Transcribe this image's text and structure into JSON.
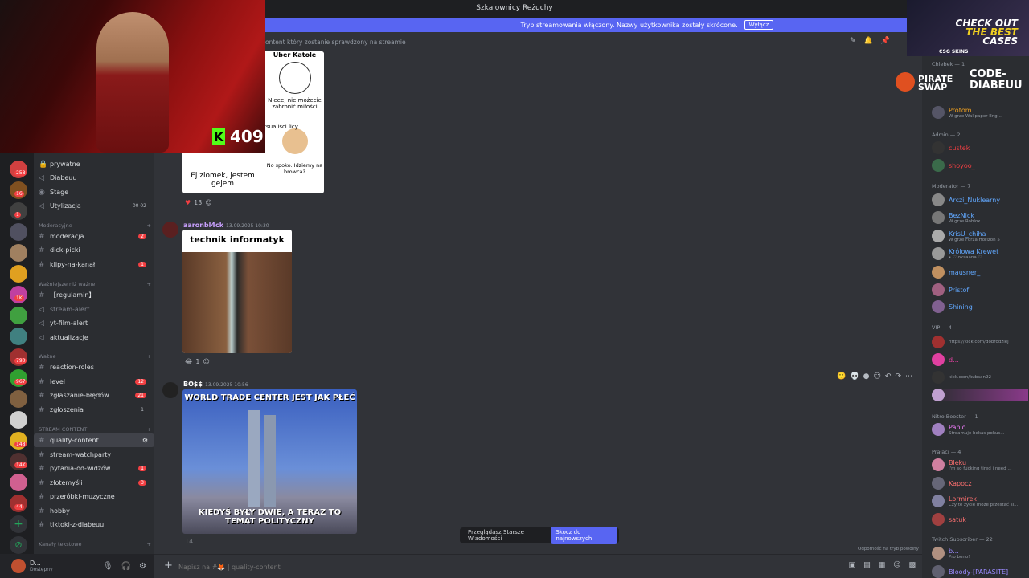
{
  "window": {
    "title": "Szkalownicy Reżuchy"
  },
  "banner": {
    "text": "Tryb streamowania włączony. Nazwy użytkownika zostały skrócone.",
    "button": "Wyłącz"
  },
  "stream": {
    "kick_count": "409"
  },
  "ads": {
    "ad1_line1": "CHECK OUT",
    "ad1_line2": "THE BEST",
    "ad1_line3": "CASES",
    "ad1_brand": "CSG SKINS",
    "ad2_left": "PIRATE SWAP",
    "ad2_right_1": "CODE-",
    "ad2_right_2": "DIABEUU"
  },
  "channel_header": {
    "desc": "ontent który zostanie sprawdzony na streamie"
  },
  "server_badges": [
    "258",
    "16",
    "1",
    "1K",
    "790",
    "967",
    "148",
    "14K",
    "44"
  ],
  "channels": {
    "top": [
      {
        "label": "prywatne"
      },
      {
        "label": "Diabeuu"
      },
      {
        "label": "Stage"
      },
      {
        "label": "Utylizacja",
        "extra": "00 02"
      }
    ],
    "cat_moderacyjne": "Moderacyjne",
    "moderacyjne": [
      {
        "label": "moderacja",
        "count": "2"
      },
      {
        "label": "dick-picki"
      },
      {
        "label": "klipy-na-kanał",
        "count": "1"
      }
    ],
    "cat_wazniejsze": "Ważniejsze niż ważne",
    "wazniejsze": [
      {
        "label": "【regulamin】"
      },
      {
        "label": "stream-alert"
      },
      {
        "label": "yt-film-alert"
      },
      {
        "label": "aktualizacje"
      }
    ],
    "cat_wazne": "Ważne",
    "wazne": [
      {
        "label": "reaction-roles"
      },
      {
        "label": "level",
        "count": "12"
      },
      {
        "label": "zgłaszanie-błędów",
        "count": "21"
      },
      {
        "label": "zgłoszenia",
        "count": "1"
      }
    ],
    "cat_stream": "STREAM CONTENT",
    "stream": [
      {
        "label": "quality-content"
      },
      {
        "label": "stream-watchparty"
      },
      {
        "label": "pytania-od-widzów",
        "count": "1"
      },
      {
        "label": "złotemyśli",
        "count": "3"
      },
      {
        "label": "przeróbki-muzyczne"
      },
      {
        "label": "hobby"
      },
      {
        "label": "tiktoki-z-diabeuu"
      }
    ],
    "cat_tekstowe": "Kanały tekstowe"
  },
  "user": {
    "name": "D...",
    "status": "Dostępny"
  },
  "messages": [
    {
      "meme_top": "Uber Katole",
      "meme_mid": "Nieee, nie możecie zabronić miłości",
      "meme_left": "ksualiści licy",
      "meme_bottom_left": "Ej ziomek, jestem gejem",
      "meme_bottom_right": "No spoko. Idziemy na browca?",
      "reaction_count": "13"
    },
    {
      "author": "aaronbl4ck",
      "time": "13.09.2025 10:30",
      "meme_title": "technik informatyk",
      "reaction_count": "1"
    },
    {
      "author": "BO$$",
      "time": "13.09.2025 10:56",
      "meme_top": "WORLD TRADE CENTER JEST JAK PŁEĆ",
      "meme_bottom": "KIEDYŚ BYŁY DWIE, A TERAZ TO TEMAT POLITYCZNY",
      "reaction_count": "14"
    }
  ],
  "old_messages": {
    "text": "Przeglądasz Starsze Wiadomości",
    "button": "Skocz do najnowszych"
  },
  "composer": {
    "placeholder": "Napisz na #🦊 | quality-content",
    "resilience": "Odporność na tryb powolny"
  },
  "members": {
    "cat_chlebek": "Chlebek — 1",
    "chlebek": [
      {
        "name": "Protom",
        "status": "W grze Wallpaper Eng..."
      }
    ],
    "cat_admin": "Admin — 2",
    "admin": [
      {
        "name": "custek"
      },
      {
        "name": "shoyoo_"
      }
    ],
    "cat_moderator": "Moderator — 7",
    "moderator": [
      {
        "name": "Arczi_Nuklearny"
      },
      {
        "name": "BezNick",
        "status": "W grze Roblox"
      },
      {
        "name": "KrisU_chiha",
        "status": "W grze Forza Horizon 5"
      },
      {
        "name": "Królowa Krewet",
        "status": "• ♡ oksaana ♡"
      },
      {
        "name": "mausner_"
      },
      {
        "name": "Pristof"
      },
      {
        "name": "Shining"
      }
    ],
    "cat_vip": "VIP — 4",
    "vip": [
      {
        "name": "",
        "status": "https://kick.com/dobrodziej"
      },
      {
        "name": "d..."
      },
      {
        "name": "",
        "status": "kick.com/kubsan92"
      },
      {
        "name": ""
      }
    ],
    "cat_booster": "Nitro Booster — 1",
    "booster": [
      {
        "name": "Pablo",
        "status": "Streamuje bekas pokus..."
      }
    ],
    "cat_pralaci": "Prałaci — 4",
    "pralaci": [
      {
        "name": "Bleku_",
        "status": "I'm so fucking tired i need ..."
      },
      {
        "name": "Kapocz"
      },
      {
        "name": "Lormirek",
        "status": "Czy te życie może przestać si..."
      },
      {
        "name": "satuk"
      }
    ],
    "cat_twitch": "Twitch Subscriber — 22",
    "twitch": [
      {
        "name": "b...",
        "status": "Pro bono!"
      },
      {
        "name": "Bloody-[PARASITE]"
      }
    ]
  },
  "colors": {
    "blurple": "#5865f2",
    "kick_green": "#53fc18",
    "mod_blue": "#61a8ff",
    "orange": "#f0a020"
  }
}
